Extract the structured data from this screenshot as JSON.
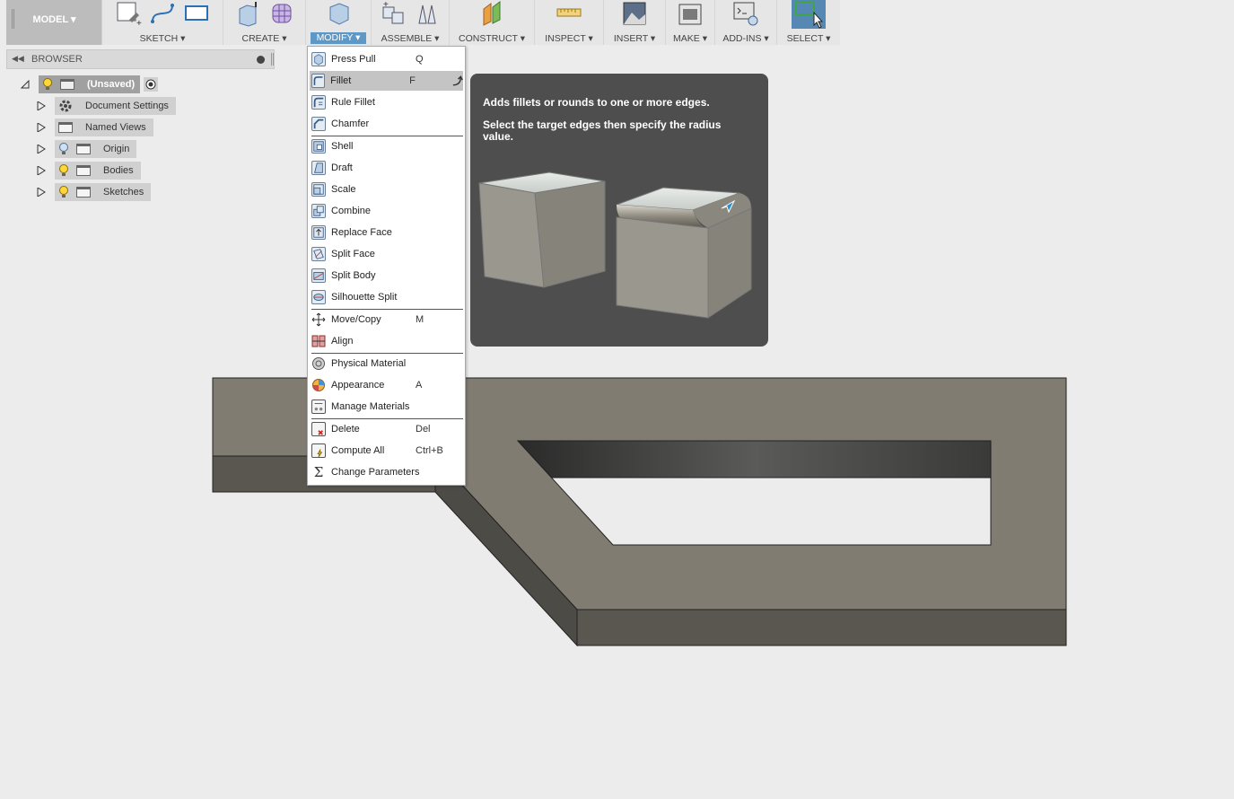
{
  "toolbar": {
    "workspace_label": "MODEL",
    "groups": [
      {
        "label": "SKETCH",
        "icons": [
          "create-sketch-icon",
          "spline-icon",
          "rectangle-icon"
        ]
      },
      {
        "label": "CREATE",
        "icons": [
          "extrude-box-icon",
          "form-icon"
        ]
      },
      {
        "label": "MODIFY",
        "icons": [
          "press-pull-icon"
        ]
      },
      {
        "label": "ASSEMBLE",
        "icons": [
          "new-component-icon",
          "joint-icon"
        ]
      },
      {
        "label": "CONSTRUCT",
        "icons": [
          "offset-plane-icon"
        ]
      },
      {
        "label": "INSPECT",
        "icons": [
          "measure-icon"
        ]
      },
      {
        "label": "INSERT",
        "icons": [
          "insert-image-icon"
        ]
      },
      {
        "label": "MAKE",
        "icons": [
          "3d-print-icon"
        ]
      },
      {
        "label": "ADD-INS",
        "icons": [
          "scripts-icon"
        ]
      },
      {
        "label": "SELECT",
        "icons": [
          "select-icon"
        ]
      }
    ],
    "dropdown_glyph": "▾"
  },
  "browser": {
    "title": "BROWSER",
    "root_label": "(Unsaved)",
    "items": [
      {
        "label": "Document Settings",
        "icon": "gear-icon"
      },
      {
        "label": "Named Views",
        "icon": "folder-icon"
      },
      {
        "label": "Origin",
        "icon": "folder-icon"
      },
      {
        "label": "Bodies",
        "icon": "folder-icon"
      },
      {
        "label": "Sketches",
        "icon": "folder-icon"
      }
    ]
  },
  "modify_menu": {
    "items": [
      {
        "label": "Press Pull",
        "shortcut": "Q",
        "icon": "press-pull-icon"
      },
      {
        "label": "Fillet",
        "shortcut": "F",
        "icon": "fillet-icon"
      },
      {
        "label": "Rule Fillet",
        "shortcut": "",
        "icon": "rule-fillet-icon"
      },
      {
        "label": "Chamfer",
        "shortcut": "",
        "icon": "chamfer-icon"
      },
      {
        "label": "Shell",
        "shortcut": "",
        "icon": "shell-icon"
      },
      {
        "label": "Draft",
        "shortcut": "",
        "icon": "draft-icon"
      },
      {
        "label": "Scale",
        "shortcut": "",
        "icon": "scale-icon"
      },
      {
        "label": "Combine",
        "shortcut": "",
        "icon": "combine-icon"
      },
      {
        "label": "Replace Face",
        "shortcut": "",
        "icon": "replace-face-icon"
      },
      {
        "label": "Split Face",
        "shortcut": "",
        "icon": "split-face-icon"
      },
      {
        "label": "Split Body",
        "shortcut": "",
        "icon": "split-body-icon"
      },
      {
        "label": "Silhouette Split",
        "shortcut": "",
        "icon": "silhouette-split-icon"
      },
      {
        "label": "Move/Copy",
        "shortcut": "M",
        "icon": "move-icon"
      },
      {
        "label": "Align",
        "shortcut": "",
        "icon": "align-icon"
      },
      {
        "label": "Physical Material",
        "shortcut": "",
        "icon": "physical-material-icon"
      },
      {
        "label": "Appearance",
        "shortcut": "A",
        "icon": "appearance-icon"
      },
      {
        "label": "Manage Materials",
        "shortcut": "",
        "icon": "manage-materials-icon"
      },
      {
        "label": "Delete",
        "shortcut": "Del",
        "icon": "delete-icon"
      },
      {
        "label": "Compute All",
        "shortcut": "Ctrl+B",
        "icon": "compute-all-icon"
      },
      {
        "label": "Change Parameters",
        "shortcut": "",
        "icon": "sigma-icon"
      }
    ],
    "highlighted": "Fillet"
  },
  "tooltip": {
    "line1": "Adds fillets or rounds to one or more edges.",
    "line2": "Select the target edges then specify the radius value."
  },
  "colors": {
    "active_tab": "#5e98c7",
    "tooltip_bg": "#4e4e4e",
    "model_top": "#807c72",
    "model_side": "#595750"
  }
}
